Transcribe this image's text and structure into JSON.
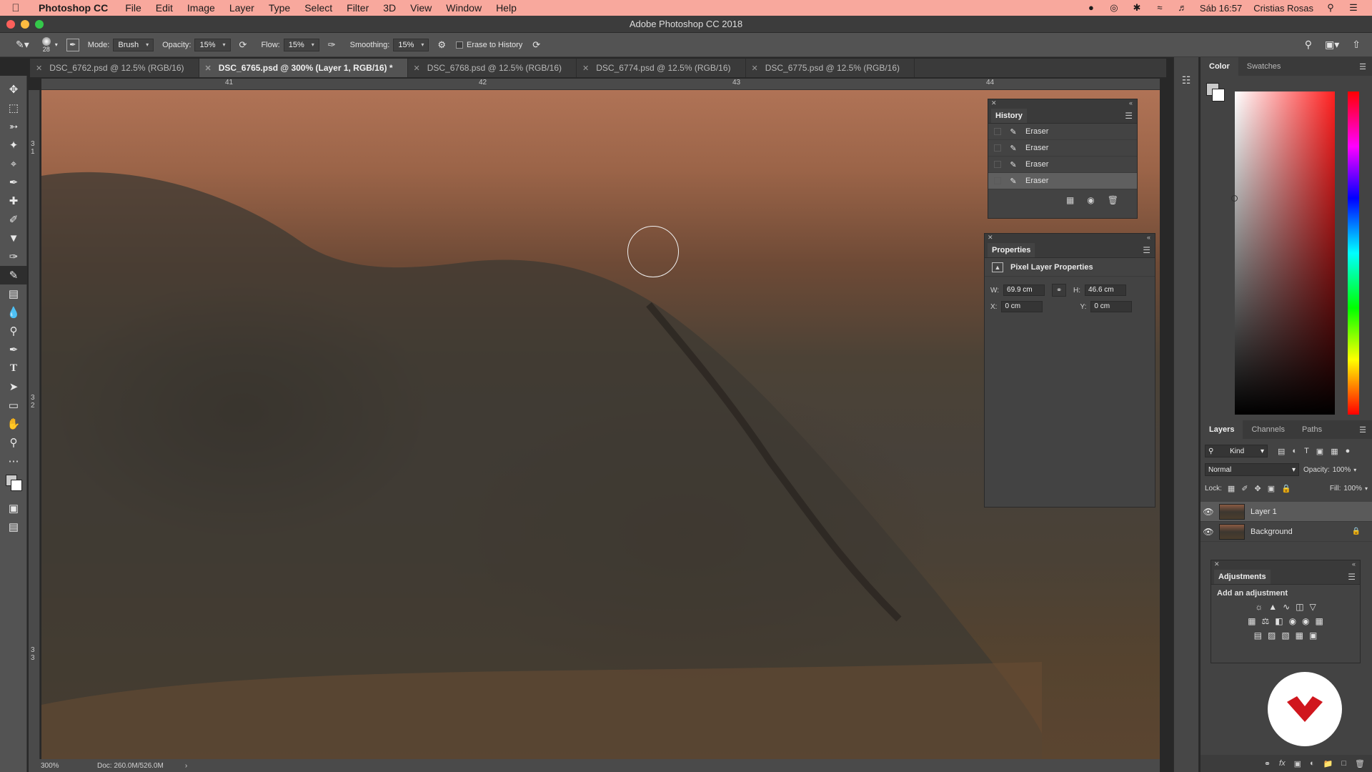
{
  "menubar": {
    "app_name": "Photoshop CC",
    "items": [
      "File",
      "Edit",
      "Image",
      "Layer",
      "Type",
      "Select",
      "Filter",
      "3D",
      "View",
      "Window",
      "Help"
    ],
    "clock": "Sáb 16:57",
    "user": "Cristias Rosas"
  },
  "window": {
    "title": "Adobe Photoshop CC 2018"
  },
  "options": {
    "brush_size": "28",
    "mode_label": "Mode:",
    "mode_value": "Brush",
    "opacity_label": "Opacity:",
    "opacity_value": "15%",
    "flow_label": "Flow:",
    "flow_value": "15%",
    "smoothing_label": "Smoothing:",
    "smoothing_value": "15%",
    "erase_history_label": "Erase to History"
  },
  "tabs": [
    "DSC_6762.psd @ 12.5% (RGB/16)",
    "DSC_6765.psd @ 300% (Layer 1, RGB/16) *",
    "DSC_6768.psd @ 12.5% (RGB/16)",
    "DSC_6774.psd @ 12.5% (RGB/16)",
    "DSC_6775.psd @ 12.5% (RGB/16)"
  ],
  "ruler": {
    "h": [
      "41",
      "42",
      "43",
      "44"
    ],
    "v": [
      "3 1",
      "3 2",
      "3 3"
    ]
  },
  "status": {
    "zoom": "300%",
    "doc": "Doc: 260.0M/526.0M"
  },
  "history": {
    "title": "History",
    "items": [
      "Eraser",
      "Eraser",
      "Eraser",
      "Eraser"
    ]
  },
  "properties": {
    "title": "Properties",
    "subtitle": "Pixel Layer Properties",
    "w_label": "W:",
    "w_value": "69.9 cm",
    "h_label": "H:",
    "h_value": "46.6 cm",
    "x_label": "X:",
    "x_value": "0 cm",
    "y_label": "Y:",
    "y_value": "0 cm"
  },
  "color_panel": {
    "tabs": [
      "Color",
      "Swatches"
    ]
  },
  "layers_panel": {
    "tabs": [
      "Layers",
      "Channels",
      "Paths"
    ],
    "kind_label": "Kind",
    "blend_mode": "Normal",
    "opacity_label": "Opacity:",
    "opacity_value": "100%",
    "lock_label": "Lock:",
    "fill_label": "Fill:",
    "fill_value": "100%",
    "layers": [
      "Layer 1",
      "Background"
    ]
  },
  "adjustments": {
    "title": "Adjustments",
    "subtitle": "Add an adjustment"
  },
  "colors": {
    "menubar": "#f8a89d",
    "ui_dark": "#535353",
    "logo_red": "#d0161d"
  }
}
